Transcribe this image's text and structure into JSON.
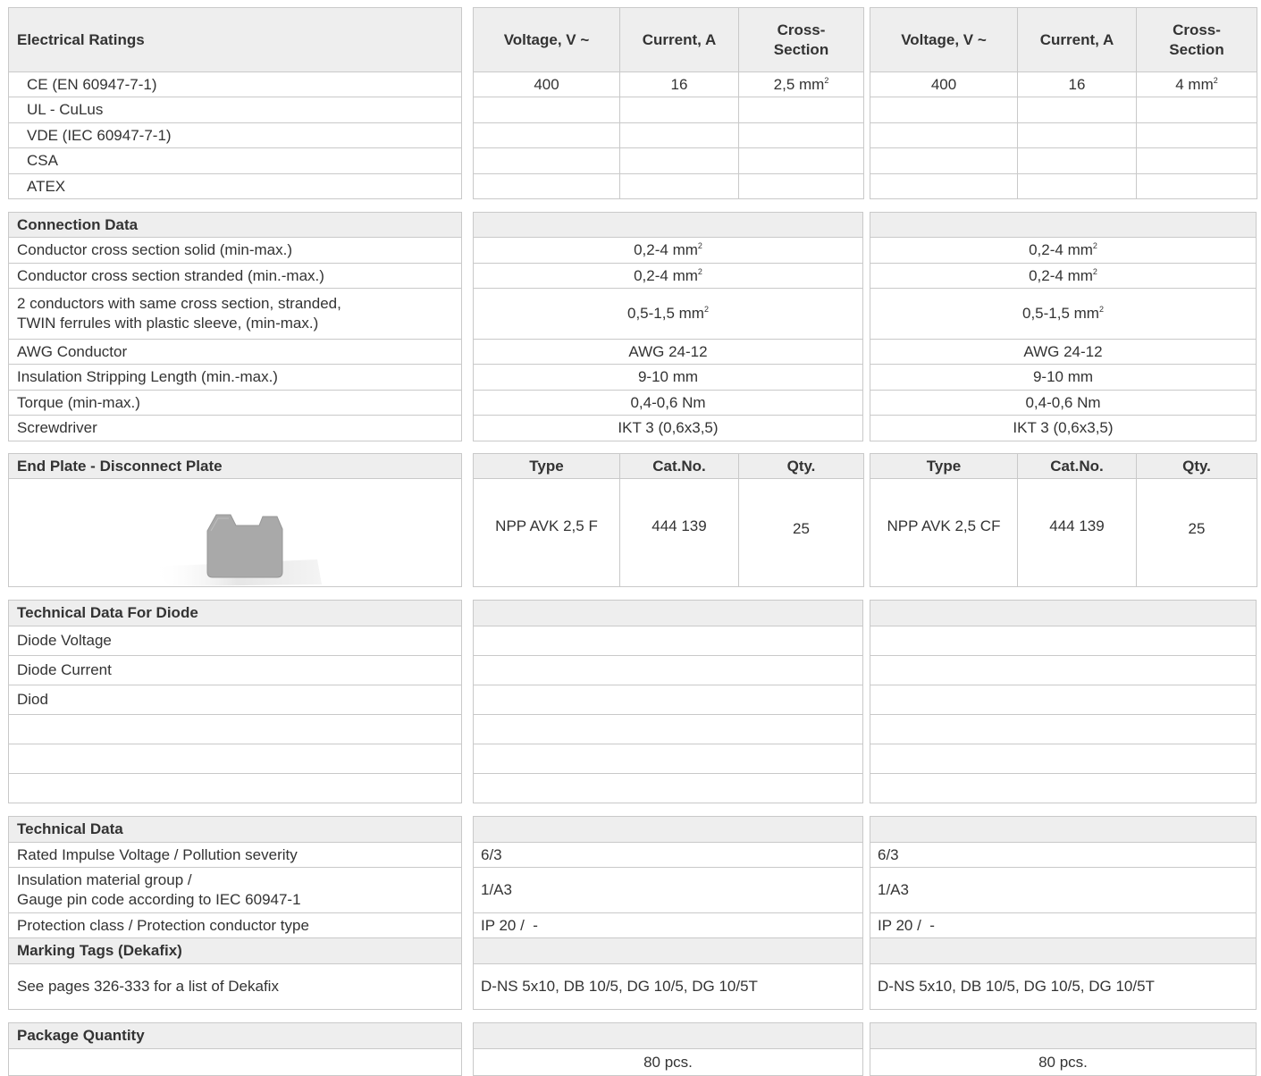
{
  "electrical_ratings": {
    "title": "Electrical Ratings",
    "col_voltage": "Voltage, V ~",
    "col_current": "Current, A",
    "col_cross_1": "Cross-",
    "col_cross_2": "Section",
    "rows": [
      {
        "label": "CE (EN 60947-7-1)",
        "a_voltage": "400",
        "a_current": "16",
        "a_cross": "2,5 mm",
        "a_sup": "2",
        "b_voltage": "400",
        "b_current": "16",
        "b_cross": "4 mm",
        "b_sup": "2"
      },
      {
        "label": "UL - CuLus"
      },
      {
        "label": "VDE (IEC 60947-7-1)"
      },
      {
        "label": "CSA"
      },
      {
        "label": "ATEX"
      }
    ]
  },
  "connection_data": {
    "title": "Connection Data",
    "rows": [
      {
        "label": "Conductor cross section solid (min-max.)",
        "a": "0,2-4 mm",
        "b": "0,2-4 mm",
        "sup": "2"
      },
      {
        "label": "Conductor cross section stranded (min.-max.)",
        "a": "0,2-4 mm",
        "b": "0,2-4 mm",
        "sup": "2"
      },
      {
        "label_1": "2 conductors with same cross section, stranded,",
        "label_2": "TWIN ferrules with plastic sleeve, (min-max.)",
        "a": "0,5-1,5 mm",
        "b": "0,5-1,5 mm",
        "sup": "2"
      },
      {
        "label": "AWG Conductor",
        "a": "AWG 24-12",
        "b": "AWG 24-12"
      },
      {
        "label": "Insulation Stripping Length (min.-max.)",
        "a": "9-10 mm",
        "b": "9-10 mm"
      },
      {
        "label": "Torque (min-max.)",
        "a": "0,4-0,6 Nm",
        "b": "0,4-0,6 Nm"
      },
      {
        "label": "Screwdriver",
        "a": "IKT 3 (0,6x3,5)",
        "b": "IKT 3 (0,6x3,5)"
      }
    ]
  },
  "end_plate": {
    "title": "End Plate - Disconnect Plate",
    "col_type": "Type",
    "col_cat": "Cat.No.",
    "col_qty": "Qty.",
    "a": {
      "type": "NPP AVK 2,5 F",
      "cat": "444 139",
      "qty": "25"
    },
    "b": {
      "type": "NPP AVK 2,5 CF",
      "cat": "444 139",
      "qty": "25"
    },
    "plate_color": "#a9a9a9"
  },
  "diode": {
    "title": "Technical Data For Diode",
    "rows": [
      "Diode Voltage",
      "Diode Current",
      "Diod",
      "",
      "",
      ""
    ]
  },
  "technical_data": {
    "title": "Technical Data",
    "rows": [
      {
        "label": "Rated Impulse Voltage / Pollution severity",
        "a": "6/3",
        "b": "6/3"
      },
      {
        "label_1": "Insulation material group /",
        "label_2": "Gauge pin code according to IEC 60947-1",
        "a": "1/A3",
        "b": "1/A3"
      },
      {
        "label": "Protection class / Protection conductor type",
        "a": "IP 20 /  -",
        "b": "IP 20 /  -"
      }
    ],
    "marking_title": "Marking Tags (Dekafix)",
    "marking_label": "See pages 326-333 for a list of Dekafix",
    "marking_a": "D-NS 5x10, DB 10/5, DG 10/5, DG 10/5T",
    "marking_b": "D-NS 5x10, DB 10/5, DG 10/5, DG 10/5T"
  },
  "package": {
    "title": "Package Quantity",
    "a": "80 pcs.",
    "b": "80 pcs."
  },
  "colors": {
    "header_bg": "#eeeeee",
    "border": "#c9c9c9",
    "text": "#333333"
  }
}
